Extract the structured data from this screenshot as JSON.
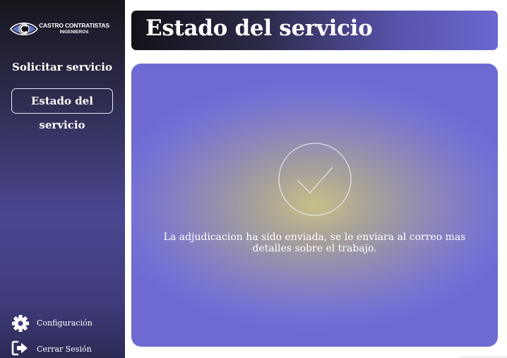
{
  "sidebar": {
    "logo": {
      "title": "CASTRO CONTRATISTAS",
      "subtitle": "INGENIEROS",
      "icon": "eye-c-logo"
    },
    "nav": [
      {
        "label": "Solicitar servicio",
        "active": false
      },
      {
        "label": "Estado del servicio",
        "active": true
      }
    ],
    "bottom": [
      {
        "label": "Configuración",
        "icon": "gear-icon"
      },
      {
        "label": "Cerrar Sesión",
        "icon": "logout-icon"
      }
    ]
  },
  "header": {
    "title": "Estado del servicio"
  },
  "status": {
    "icon": "check-circle-icon",
    "message": "La adjudicacion ha sido enviada, se le enviara al correo mas detalles sobre el trabajo."
  },
  "colors": {
    "sidebar_top": "#16161d",
    "sidebar_mid": "#4b4791",
    "panel_accent": "#6e6ad2",
    "header_end": "#6c66d0"
  }
}
